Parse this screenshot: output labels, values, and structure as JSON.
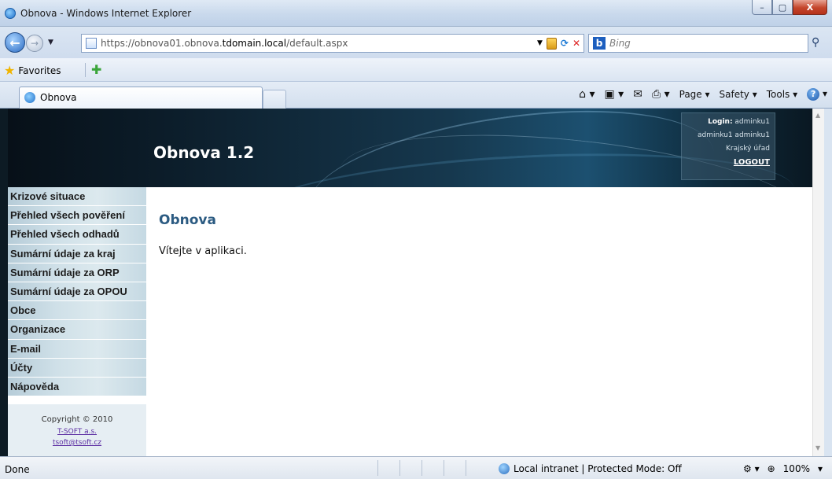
{
  "window": {
    "title": "Obnova - Windows Internet Explorer",
    "controls": {
      "minimize": "–",
      "maximize": "▢",
      "close": "X"
    }
  },
  "address": {
    "url_prefix": "https://obnova01.obnova.",
    "url_domain": "tdomain.local",
    "url_path": "/default.aspx",
    "search_placeholder": "Bing"
  },
  "favorites": {
    "label": "Favorites"
  },
  "tab": {
    "label": "Obnova"
  },
  "commandbar": {
    "page": "Page ▾",
    "safety": "Safety ▾",
    "tools": "Tools ▾"
  },
  "header": {
    "app_title": "Obnova 1.2",
    "login_label": "Login:",
    "login_user": "adminku1",
    "user_fullname": "adminku1 adminku1",
    "office": "Krajský úřad",
    "logout": "LOGOUT"
  },
  "menu": [
    "Krizové situace",
    "Přehled všech pověření",
    "Přehled všech odhadů",
    "Sumární údaje za kraj",
    "Sumární údaje za ORP",
    "Sumární údaje za OPOU",
    "Obce",
    "Organizace",
    "E-mail",
    "Účty",
    "Nápověda"
  ],
  "footer": {
    "copyright": "Copyright © 2010",
    "company": "T-SOFT a.s.",
    "email": "tsoft@tsoft.cz"
  },
  "main": {
    "heading": "Obnova",
    "welcome": "Vítejte v aplikaci."
  },
  "status": {
    "text": "Done",
    "zone": "Local intranet | Protected Mode: Off",
    "zoom": "100%"
  }
}
